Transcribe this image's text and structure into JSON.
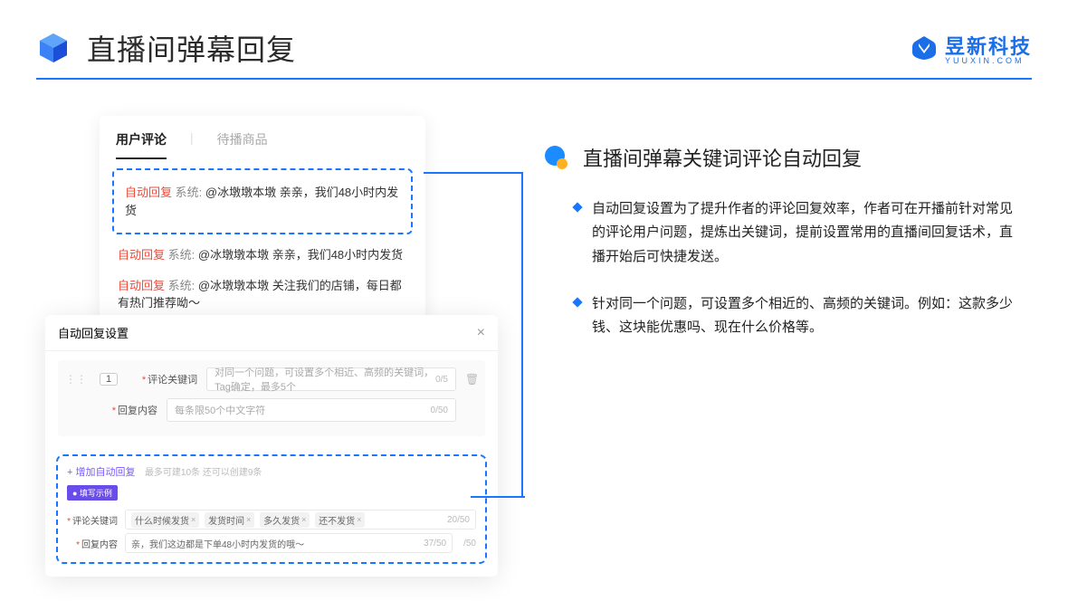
{
  "header": {
    "title": "直播间弹幕回复",
    "brand": "昱新科技",
    "brandSub": "YUUXIN.COM"
  },
  "upperCard": {
    "tabActive": "用户评论",
    "tabInactive": "待播商品",
    "highlighted": {
      "tag": "自动回复",
      "sys": "系统:",
      "text": "@冰墩墩本墩 亲亲，我们48小时内发货"
    },
    "comments": [
      {
        "tag": "自动回复",
        "sys": "系统:",
        "text": "@冰墩墩本墩 亲亲，我们48小时内发货"
      },
      {
        "tag": "自动回复",
        "sys": "系统:",
        "text": "@冰墩墩本墩 关注我们的店铺，每日都有热门推荐呦～"
      }
    ]
  },
  "lowerCard": {
    "title": "自动回复设置",
    "idx": "1",
    "keywordLabel": "评论关键词",
    "keywordPlaceholder": "对同一个问题，可设置多个相近、高频的关键词，Tag确定，最多5个",
    "keywordCount": "0/5",
    "contentLabel": "回复内容",
    "contentPlaceholder": "每条限50个中文字符",
    "contentCount": "0/50",
    "addLink": "+ 增加自动回复",
    "addHint": "最多可建10条 还可以创建9条",
    "exampleTag": "● 填写示例",
    "exKeywordLabel": "评论关键词",
    "exTags": [
      "什么时候发货",
      "发货时间",
      "多久发货",
      "还不发货"
    ],
    "exKeywordCount": "20/50",
    "exContentLabel": "回复内容",
    "exContentText": "亲，我们这边都是下单48小时内发货的哦～",
    "exContentCount": "37/50",
    "trailCount": "/50"
  },
  "right": {
    "sectionTitle": "直播间弹幕关键词评论自动回复",
    "bullets": [
      "自动回复设置为了提升作者的评论回复效率，作者可在开播前针对常见的评论用户问题，提炼出关键词，提前设置常用的直播间回复话术，直播开始后可快捷发送。",
      "针对同一个问题，可设置多个相近的、高频的关键词。例如：这款多少钱、这块能优惠吗、现在什么价格等。"
    ]
  }
}
